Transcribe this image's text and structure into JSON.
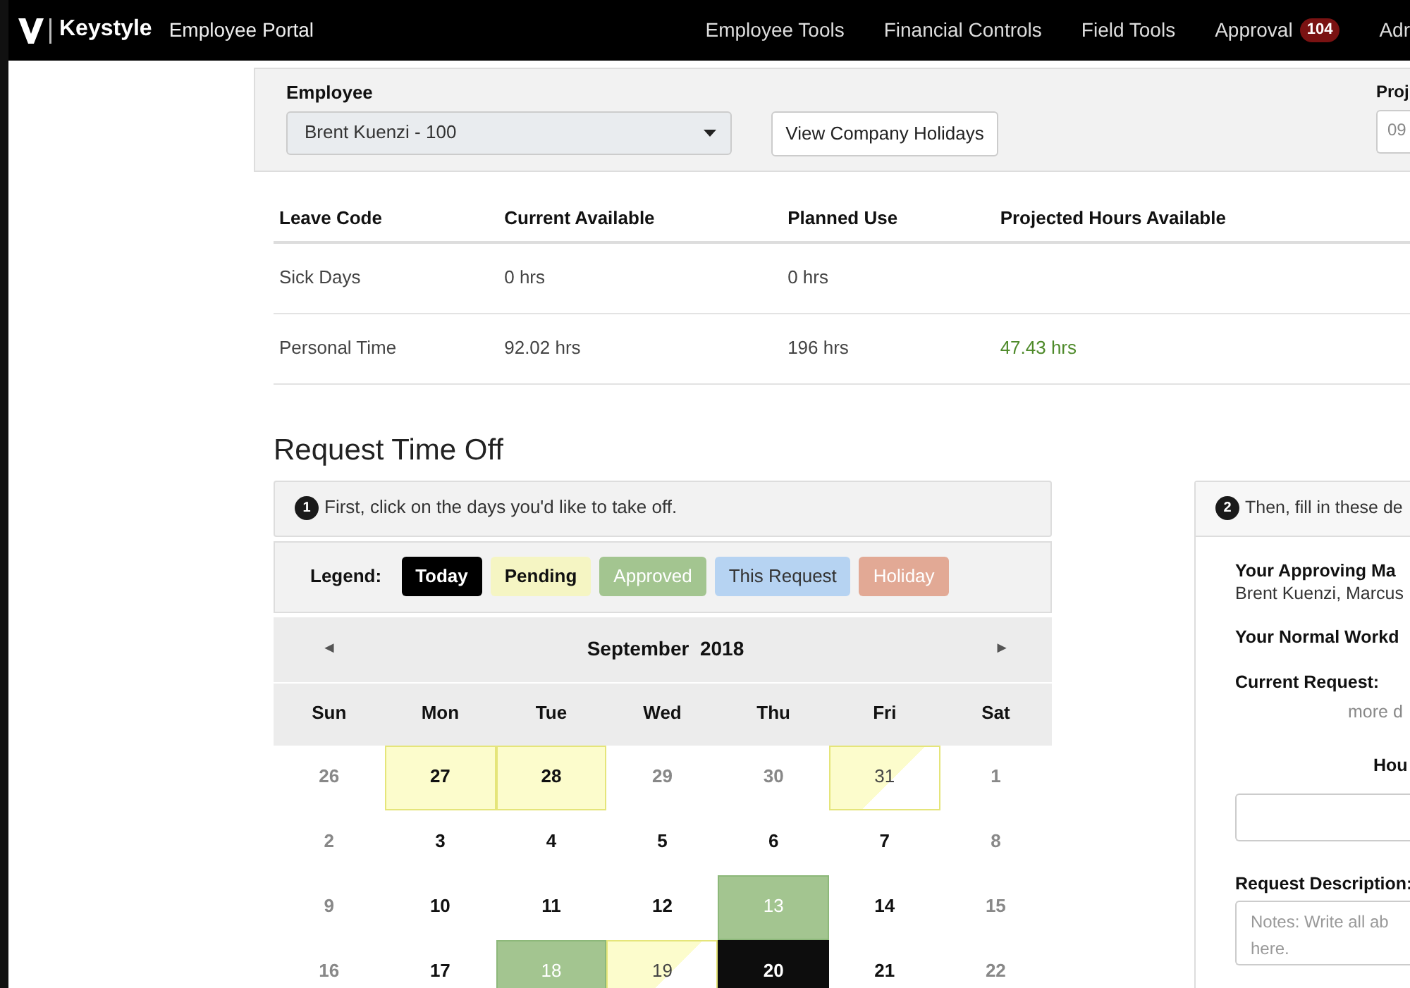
{
  "navbar": {
    "brand": "Keystyle",
    "title": "Employee Portal",
    "links": [
      {
        "label": "Employee Tools"
      },
      {
        "label": "Financial Controls"
      },
      {
        "label": "Field Tools"
      },
      {
        "label": "Approval",
        "badge": "104"
      },
      {
        "label": "Adr"
      }
    ]
  },
  "filters": {
    "employee_label": "Employee",
    "employee_value": "Brent Kuenzi - 100",
    "holidays_button": "View Company Holidays",
    "projected_label": "Proj",
    "projected_value": "09"
  },
  "balances": {
    "columns": [
      "Leave Code",
      "Current Available",
      "Planned Use",
      "Projected Hours Available"
    ],
    "rows": [
      {
        "cells": [
          "Sick Days",
          "0 hrs",
          "0 hrs",
          ""
        ]
      },
      {
        "cells": [
          "Personal Time",
          "92.02 hrs",
          "196 hrs",
          "47.43 hrs"
        ],
        "projected_positive": true
      }
    ]
  },
  "request_title": "Request Time Off",
  "step1": {
    "number": "1",
    "text": "First, click on the days you'd like to take off."
  },
  "legend": {
    "label": "Legend:",
    "items": [
      {
        "label": "Today",
        "kind": "today"
      },
      {
        "label": "Pending",
        "kind": "pending"
      },
      {
        "label": "Approved",
        "kind": "approved"
      },
      {
        "label": "This Request",
        "kind": "request"
      },
      {
        "label": "Holiday",
        "kind": "holiday"
      }
    ]
  },
  "calendar": {
    "prev": "◄",
    "next": "►",
    "month": "September  2018",
    "weekdays": [
      "Sun",
      "Mon",
      "Tue",
      "Wed",
      "Thu",
      "Fri",
      "Sat"
    ],
    "weeks": [
      [
        {
          "day": "26",
          "muted": true,
          "kind": "plain"
        },
        {
          "day": "27",
          "muted": false,
          "kind": "pending"
        },
        {
          "day": "28",
          "muted": false,
          "kind": "pending"
        },
        {
          "day": "29",
          "muted": true,
          "kind": "plain"
        },
        {
          "day": "30",
          "muted": true,
          "kind": "plain"
        },
        {
          "day": "31",
          "muted": false,
          "kind": "partial"
        },
        {
          "day": "1",
          "muted": true,
          "kind": "plain"
        }
      ],
      [
        {
          "day": "2",
          "muted": true,
          "kind": "plain"
        },
        {
          "day": "3",
          "muted": false,
          "kind": "plain"
        },
        {
          "day": "4",
          "muted": false,
          "kind": "plain"
        },
        {
          "day": "5",
          "muted": false,
          "kind": "plain"
        },
        {
          "day": "6",
          "muted": false,
          "kind": "plain"
        },
        {
          "day": "7",
          "muted": false,
          "kind": "plain"
        },
        {
          "day": "8",
          "muted": true,
          "kind": "plain"
        }
      ],
      [
        {
          "day": "9",
          "muted": true,
          "kind": "plain"
        },
        {
          "day": "10",
          "muted": false,
          "kind": "plain"
        },
        {
          "day": "11",
          "muted": false,
          "kind": "plain"
        },
        {
          "day": "12",
          "muted": false,
          "kind": "plain"
        },
        {
          "day": "13",
          "muted": false,
          "kind": "approved"
        },
        {
          "day": "14",
          "muted": false,
          "kind": "plain"
        },
        {
          "day": "15",
          "muted": true,
          "kind": "plain"
        }
      ],
      [
        {
          "day": "16",
          "muted": true,
          "kind": "plain"
        },
        {
          "day": "17",
          "muted": false,
          "kind": "plain"
        },
        {
          "day": "18",
          "muted": false,
          "kind": "approved"
        },
        {
          "day": "19",
          "muted": false,
          "kind": "partial"
        },
        {
          "day": "20",
          "muted": false,
          "kind": "today"
        },
        {
          "day": "21",
          "muted": false,
          "kind": "plain"
        },
        {
          "day": "22",
          "muted": true,
          "kind": "plain"
        }
      ]
    ]
  },
  "step2": {
    "number": "2",
    "text": "Then, fill in these de",
    "manager_label": "Your Approving Ma",
    "manager_value": "Brent Kuenzi, Marcus",
    "workday_label": "Your Normal Workd",
    "current_label": "Current Request:",
    "current_value": "more d",
    "hours_label": "Hou",
    "description_label": "Request Description:",
    "description_placeholder": "Notes: Write all ab\nhere."
  }
}
